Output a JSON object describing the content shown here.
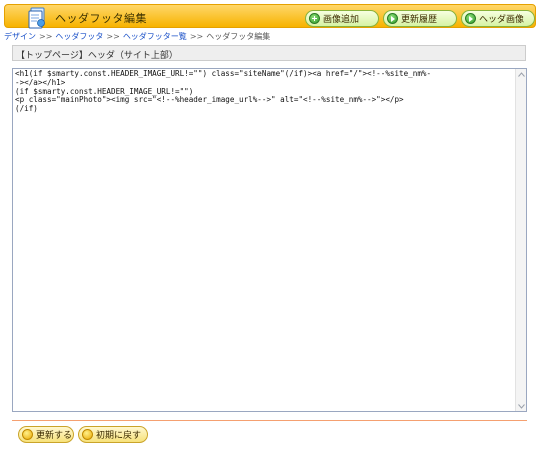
{
  "header": {
    "title": "ヘッダフッタ編集",
    "buttons": {
      "add": "画像追加",
      "history": "更新履歴",
      "header_image": "ヘッダ画像"
    }
  },
  "breadcrumb": {
    "items": [
      "デザイン",
      "ヘッダフッタ",
      "ヘッダフッター覧",
      "ヘッダフッタ編集"
    ],
    "separator": ">>"
  },
  "section": {
    "title": "【トップページ】ヘッダ（サイト上部）"
  },
  "editor": {
    "code": "<h1(if $smarty.const.HEADER_IMAGE_URL!=\"\") class=\"siteName\"(/if)><a href=\"/\"><!--%site_nm%-\n-></a></h1>\n(if $smarty.const.HEADER_IMAGE_URL!=\"\")\n<p class=\"mainPhoto\"><img src=\"<!--%header_image_url%-->\" alt=\"<!--%site_nm%-->\"></p>\n(/if)"
  },
  "footer": {
    "update_label": "更新する",
    "reset_label": "初期に戻す"
  },
  "colors": {
    "header_bg": "#f7b300",
    "link": "#1a50c8",
    "divider": "#f5a070"
  }
}
